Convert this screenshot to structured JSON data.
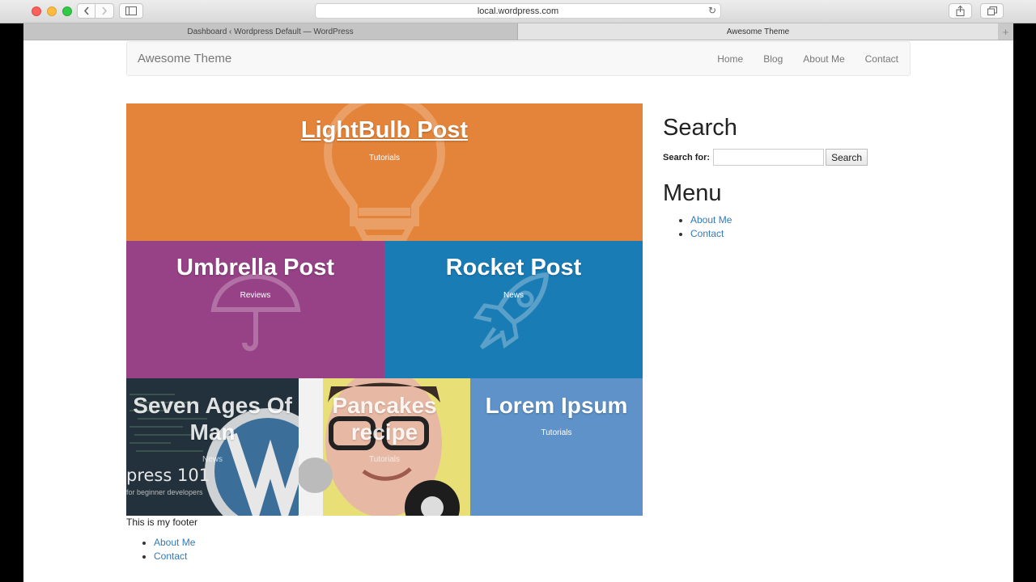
{
  "browser": {
    "url": "local.wordpress.com",
    "tabs": [
      {
        "label": "Dashboard ‹ Wordpress Default — WordPress"
      },
      {
        "label": "Awesome Theme"
      }
    ],
    "icons": {
      "back": "chevron-left-icon",
      "forward": "chevron-right-icon",
      "sidebar": "sidebar-icon",
      "reload": "reload-icon",
      "share": "share-icon",
      "tabs": "tabs-icon",
      "new_tab": "plus-icon"
    }
  },
  "site": {
    "brand": "Awesome Theme",
    "nav": [
      "Home",
      "Blog",
      "About Me",
      "Contact"
    ]
  },
  "posts": [
    {
      "title": "LightBulb Post",
      "category": "Tutorials",
      "color": "#e3843a",
      "icon": "lightbulb-icon"
    },
    {
      "title": "Umbrella Post",
      "category": "Reviews",
      "color": "#974287",
      "icon": "umbrella-icon"
    },
    {
      "title": "Rocket Post",
      "category": "News",
      "color": "#1a7cb5",
      "icon": "rocket-icon"
    },
    {
      "title": "Seven Ages Of Man",
      "category": "News",
      "image_text": "press 101",
      "image_subtext": "for beginner developers"
    },
    {
      "title": "Pancakes recipe",
      "category": "Tutorials"
    },
    {
      "title": "Lorem Ipsum",
      "category": "Tutorials",
      "color": "#5e92c8"
    }
  ],
  "sidebar": {
    "search_heading": "Search",
    "search_label": "Search for:",
    "search_value": "",
    "search_button": "Search",
    "menu_heading": "Menu",
    "menu_items": [
      "About Me",
      "Contact"
    ]
  },
  "footer": {
    "text": "This is my footer",
    "links": [
      "About Me",
      "Contact"
    ]
  }
}
